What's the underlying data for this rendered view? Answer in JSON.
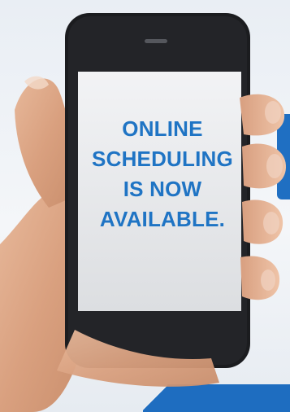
{
  "screen": {
    "lines": [
      "ONLINE",
      "SCHEDULING",
      "IS NOW",
      "AVAILABLE."
    ]
  },
  "colors": {
    "text_blue": "#1f74c4",
    "accent_blue": "#1e6dc0",
    "phone_black": "#1b1c1f",
    "screen_gray": "#e9eaec"
  }
}
